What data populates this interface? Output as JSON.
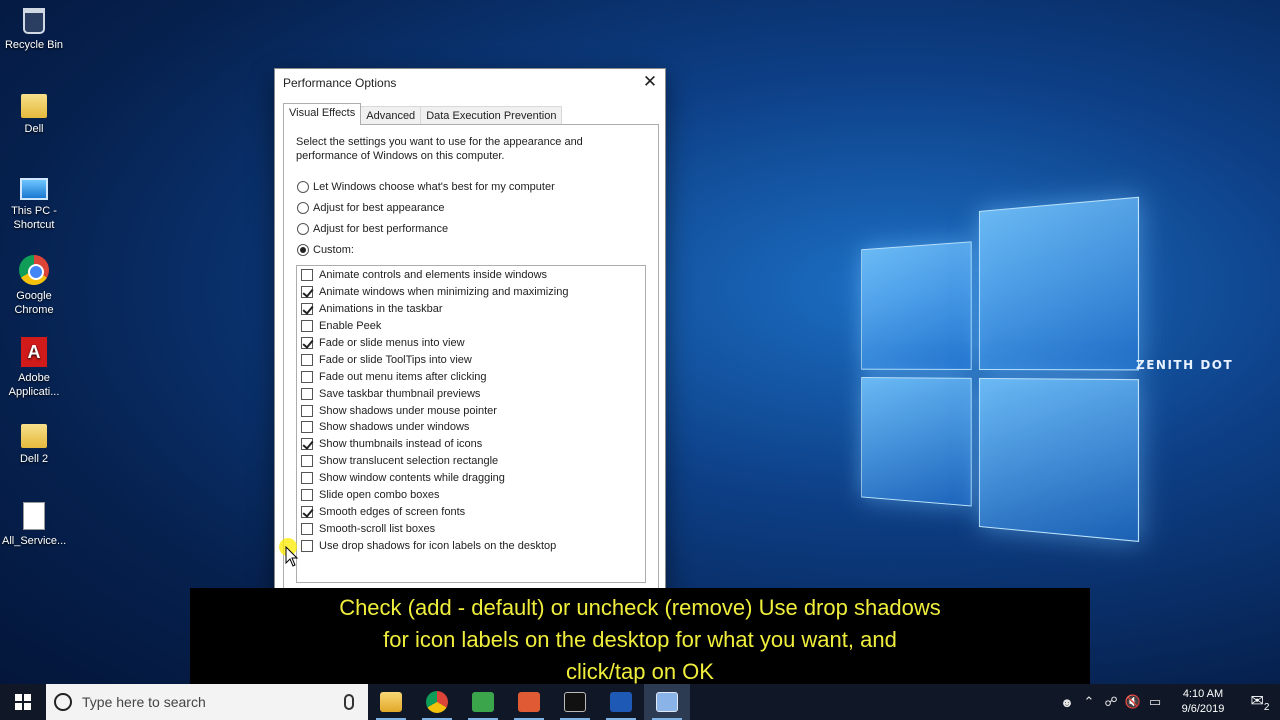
{
  "desktop": {
    "icons": [
      {
        "label": "Recycle Bin",
        "icon": "recycle-bin-icon"
      },
      {
        "label": "Dell",
        "icon": "folder-icon"
      },
      {
        "label": "This PC - Shortcut",
        "icon": "this-pc-icon"
      },
      {
        "label": "Google Chrome",
        "icon": "chrome-icon"
      },
      {
        "label": "Adobe Applicati...",
        "icon": "adobe-icon"
      },
      {
        "label": "Dell 2",
        "icon": "folder-icon"
      },
      {
        "label": "All_Service...",
        "icon": "document-icon"
      }
    ],
    "watermark": "ZENITH DOT"
  },
  "dialog": {
    "title": "Performance Options",
    "close_glyph": "✕",
    "tabs": [
      {
        "label": "Visual Effects",
        "active": true
      },
      {
        "label": "Advanced",
        "active": false
      },
      {
        "label": "Data Execution Prevention",
        "active": false
      }
    ],
    "description": "Select the settings you want to use for the appearance and performance of Windows on this computer.",
    "radios": [
      {
        "label": "Let Windows choose what's best for my computer",
        "selected": false
      },
      {
        "label": "Adjust for best appearance",
        "selected": false
      },
      {
        "label": "Adjust for best performance",
        "selected": false
      },
      {
        "label": "Custom:",
        "selected": true
      }
    ],
    "options": [
      {
        "label": "Animate controls and elements inside windows",
        "checked": false
      },
      {
        "label": "Animate windows when minimizing and maximizing",
        "checked": true
      },
      {
        "label": "Animations in the taskbar",
        "checked": true
      },
      {
        "label": "Enable Peek",
        "checked": false
      },
      {
        "label": "Fade or slide menus into view",
        "checked": true
      },
      {
        "label": "Fade or slide ToolTips into view",
        "checked": false
      },
      {
        "label": "Fade out menu items after clicking",
        "checked": false
      },
      {
        "label": "Save taskbar thumbnail previews",
        "checked": false
      },
      {
        "label": "Show shadows under mouse pointer",
        "checked": false
      },
      {
        "label": "Show shadows under windows",
        "checked": false
      },
      {
        "label": "Show thumbnails instead of icons",
        "checked": true
      },
      {
        "label": "Show translucent selection rectangle",
        "checked": false
      },
      {
        "label": "Show window contents while dragging",
        "checked": false
      },
      {
        "label": "Slide open combo boxes",
        "checked": false
      },
      {
        "label": "Smooth edges of screen fonts",
        "checked": true
      },
      {
        "label": "Smooth-scroll list boxes",
        "checked": false
      },
      {
        "label": "Use drop shadows for icon labels on the desktop",
        "checked": false
      }
    ]
  },
  "subtitle": {
    "lines": [
      "Check (add - default) or uncheck (remove) Use drop shadows",
      "for icon labels on the desktop for what you want, and",
      "click/tap on OK"
    ],
    "color": "#f0ee3c"
  },
  "taskbar": {
    "search_placeholder": "Type here to search",
    "apps": [
      {
        "name": "file-explorer-icon",
        "running": true,
        "active": false
      },
      {
        "name": "chrome-icon",
        "running": true,
        "active": false
      },
      {
        "name": "camtasia-icon",
        "running": true,
        "active": false
      },
      {
        "name": "screen-recorder-icon",
        "running": true,
        "active": false
      },
      {
        "name": "command-prompt-icon",
        "running": true,
        "active": false
      },
      {
        "name": "powershell-icon",
        "running": true,
        "active": false
      },
      {
        "name": "performance-options-icon",
        "running": true,
        "active": true
      }
    ],
    "tray": {
      "time": "4:10 AM",
      "date": "9/6/2019",
      "notification_count": "2"
    }
  }
}
